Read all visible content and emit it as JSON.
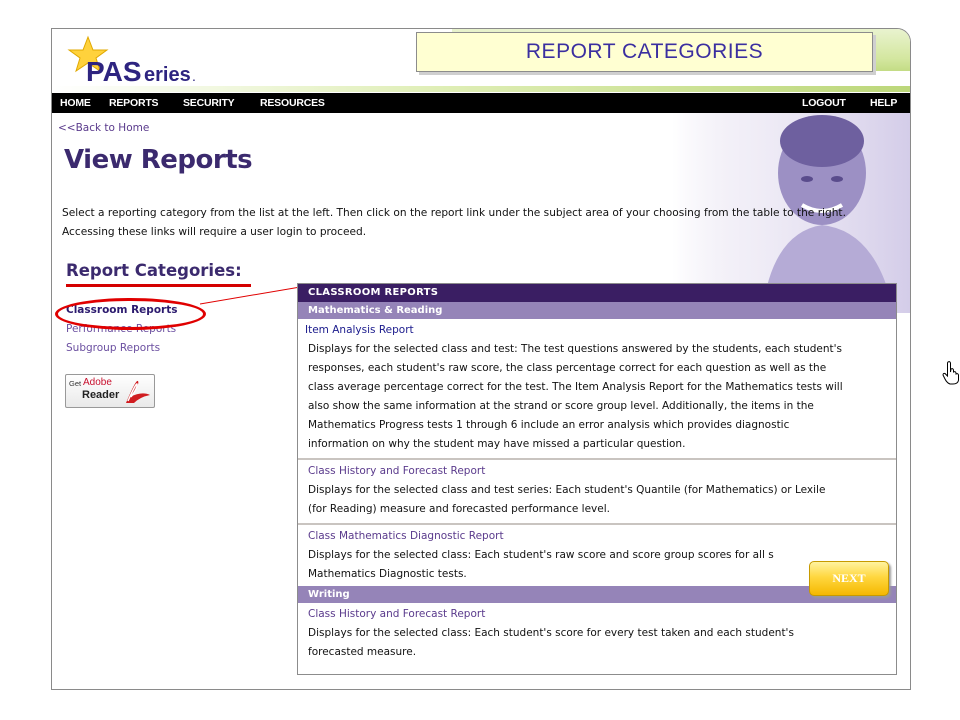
{
  "slide": {
    "title": "REPORT CATEGORIES",
    "next_label": "NEXT"
  },
  "app": {
    "logo_text": "PASeries",
    "logo_suffix": "."
  },
  "nav": {
    "left": [
      "HOME",
      "REPORTS",
      "SECURITY",
      "RESOURCES"
    ],
    "right": [
      "LOGOUT",
      "HELP"
    ]
  },
  "page": {
    "back_link": "<<Back to Home",
    "title": "View Reports",
    "intro_line1": "Select a reporting category from the list at the left. Then click on the report link under the subject area of your choosing from the table to the right.",
    "intro_line2": "Accessing these links will require a user login to proceed."
  },
  "sidebar": {
    "heading": "Report Categories:",
    "items": [
      {
        "label": "Classroom Reports",
        "active": true
      },
      {
        "label": "Performance Reports",
        "active": false
      },
      {
        "label": "Subgroup Reports",
        "active": false
      }
    ],
    "adobe": {
      "get": "Get",
      "brand": "Adobe",
      "product": "Reader"
    }
  },
  "table": {
    "header": "CLASSROOM REPORTS",
    "sections": [
      {
        "name": "Mathematics & Reading",
        "rows": [
          {
            "title": "Item Analysis Report",
            "lines": [
              "Displays for the selected class and test: The test questions answered by the students, each student's",
              "responses, each student's raw score, the class percentage correct for each question as well as the",
              "class average percentage correct for the test. The Item Analysis Report for the Mathematics tests will",
              "also show the same information at the strand or score group level. Additionally, the items in the",
              "Mathematics Progress tests 1 through 6 include an error analysis which provides diagnostic",
              "information on why the student may have missed a particular question."
            ]
          },
          {
            "title": "Class History and Forecast Report",
            "lines": [
              "Displays for the selected class and test series: Each student's Quantile (for Mathematics) or Lexile",
              "(for Reading) measure and forecasted performance level."
            ]
          },
          {
            "title": "Class Mathematics Diagnostic Report",
            "lines": [
              "Displays for the selected class: Each student's raw score and score group scores for all s",
              "Mathematics Diagnostic tests."
            ]
          }
        ]
      },
      {
        "name": "Writing",
        "rows": [
          {
            "title": "Class History and Forecast Report",
            "lines": [
              "Displays for the selected class: Each student's score for every test taken and each student's",
              "forecasted measure."
            ]
          }
        ]
      }
    ]
  },
  "colors": {
    "nav_bg": "#000000",
    "table_header": "#3a1e63",
    "section_header": "#9584b8",
    "heading_purple": "#3b2a6e",
    "highlight_red": "#e00000",
    "title_box_bg": "#ffffd2",
    "next_button": "#ffd740"
  },
  "icons": {
    "cursor": "hand-pointer-icon",
    "logo": "star-logo-icon",
    "adobe": "adobe-reader-icon"
  }
}
